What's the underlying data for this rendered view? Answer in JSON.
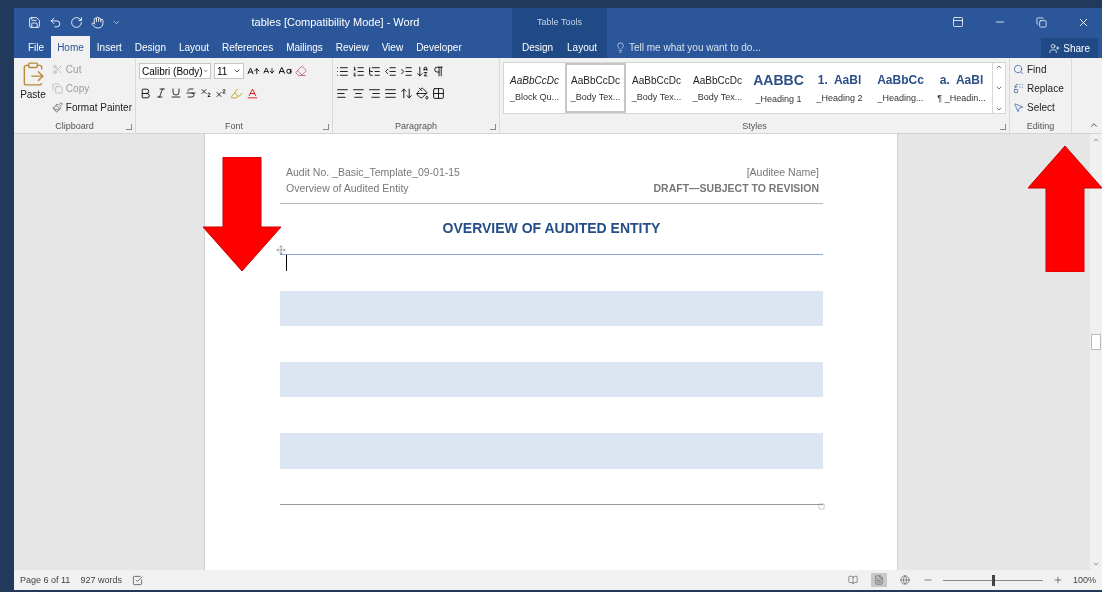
{
  "window": {
    "title": "tables [Compatibility Mode] - Word",
    "context_group": "Table Tools"
  },
  "tabs": [
    {
      "label": "File",
      "selected": false,
      "kind": "main"
    },
    {
      "label": "Home",
      "selected": true,
      "kind": "main"
    },
    {
      "label": "Insert",
      "selected": false,
      "kind": "main"
    },
    {
      "label": "Design",
      "selected": false,
      "kind": "main"
    },
    {
      "label": "Layout",
      "selected": false,
      "kind": "main"
    },
    {
      "label": "References",
      "selected": false,
      "kind": "main"
    },
    {
      "label": "Mailings",
      "selected": false,
      "kind": "main"
    },
    {
      "label": "Review",
      "selected": false,
      "kind": "main"
    },
    {
      "label": "View",
      "selected": false,
      "kind": "main"
    },
    {
      "label": "Developer",
      "selected": false,
      "kind": "main"
    },
    {
      "label": "Design",
      "selected": false,
      "kind": "contextual"
    },
    {
      "label": "Layout",
      "selected": false,
      "kind": "contextual"
    }
  ],
  "tell_me": {
    "placeholder": "Tell me what you want to do..."
  },
  "share": "Share",
  "clipboard": {
    "paste": "Paste",
    "items": [
      {
        "label": "Cut",
        "disabled": true,
        "kind": "cut"
      },
      {
        "label": "Copy",
        "disabled": true,
        "kind": "copy"
      },
      {
        "label": "Format Painter",
        "disabled": false,
        "kind": "painter"
      }
    ],
    "label": "Clipboard"
  },
  "font": {
    "name": "Calibri (Body)",
    "size": "11",
    "label": "Font"
  },
  "paragraph": {
    "label": "Paragraph"
  },
  "styles": {
    "label": "Styles",
    "items": [
      {
        "preview": "AaBbCcDc",
        "name": "_Block Qu...",
        "kind": "italic",
        "selected": false
      },
      {
        "preview": "AaBbCcDc",
        "name": "_Body Tex...",
        "kind": "body",
        "selected": true
      },
      {
        "preview": "AaBbCcDc",
        "name": "_Body Tex...",
        "kind": "body",
        "selected": false
      },
      {
        "preview": "AaBbCcDc",
        "name": "_Body Tex...",
        "kind": "body",
        "selected": false
      },
      {
        "preview": "AABBC",
        "name": "_Heading 1",
        "kind": "heading1",
        "selected": false
      },
      {
        "preview": "1.  AaBl",
        "name": "_Heading 2",
        "kind": "heading2",
        "selected": false
      },
      {
        "preview": "AaBbCc",
        "name": "_Heading...",
        "kind": "heading3",
        "selected": false
      },
      {
        "preview": "a.  AaBl",
        "name": "¶ _Headin...",
        "kind": "heading2",
        "selected": false
      }
    ]
  },
  "editing": {
    "label": "Editing",
    "items": [
      {
        "label": "Find",
        "kind": "find"
      },
      {
        "label": "Replace",
        "kind": "replace"
      },
      {
        "label": "Select",
        "kind": "select"
      }
    ]
  },
  "document": {
    "header_left": [
      "Audit No. _Basic_Template_09-01-15",
      "Overview of Audited Entity"
    ],
    "header_right": [
      "[Auditee Name]",
      "DRAFT—SUBJECT TO REVISION"
    ],
    "title": "OVERVIEW OF AUDITED ENTITY",
    "table_rows": [
      {
        "shaded": false
      },
      {
        "shaded": true
      },
      {
        "shaded": false
      },
      {
        "shaded": true
      },
      {
        "shaded": false
      },
      {
        "shaded": true
      },
      {
        "shaded": false
      }
    ]
  },
  "status_bar": {
    "page": "Page 6 of 11",
    "words": "927 words",
    "views": [
      {
        "kind": "read",
        "selected": false
      },
      {
        "kind": "print",
        "selected": true
      },
      {
        "kind": "web",
        "selected": false
      }
    ],
    "zoom": {
      "level": 0.5,
      "reading": "100%"
    }
  }
}
